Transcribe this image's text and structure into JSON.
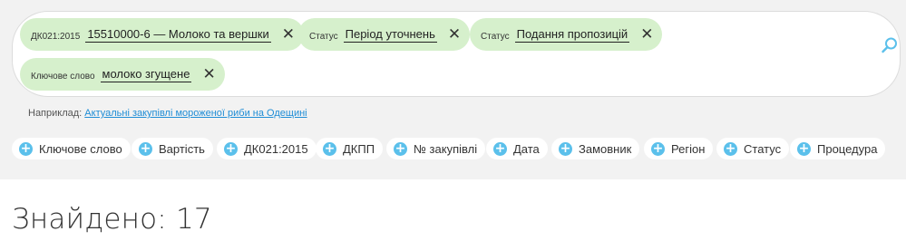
{
  "chips": [
    {
      "key": "ДК021:2015",
      "value": "15510000-6 — Молоко та вершки"
    },
    {
      "key": "Статус",
      "value": "Період уточнень"
    },
    {
      "key": "Статус",
      "value": "Подання пропозицій"
    },
    {
      "key": "Ключове слово",
      "value": "молоко згущене"
    }
  ],
  "chip_close_glyph": "✕",
  "search_icon": "search-icon",
  "example": {
    "prefix": "Наприклад:",
    "link": "Актуальні закупівлі мороженої риби на Одещині"
  },
  "filters": [
    {
      "label": "Ключове слово"
    },
    {
      "label": "Вартість"
    },
    {
      "label": "ДК021:2015"
    },
    {
      "label": "ДКПП"
    },
    {
      "label": "№ закупівлі"
    },
    {
      "label": "Дата"
    },
    {
      "label": "Замовник"
    },
    {
      "label": "Регіон"
    },
    {
      "label": "Статус"
    },
    {
      "label": "Процедура"
    }
  ],
  "plus_glyph": "+",
  "results": {
    "found": "Знайдено: 17"
  },
  "colors": {
    "chip_bg": "#d6f0cc",
    "accent": "#5bc0eb",
    "link": "#1f8dd6",
    "panel_bg": "#f2f2f2"
  }
}
